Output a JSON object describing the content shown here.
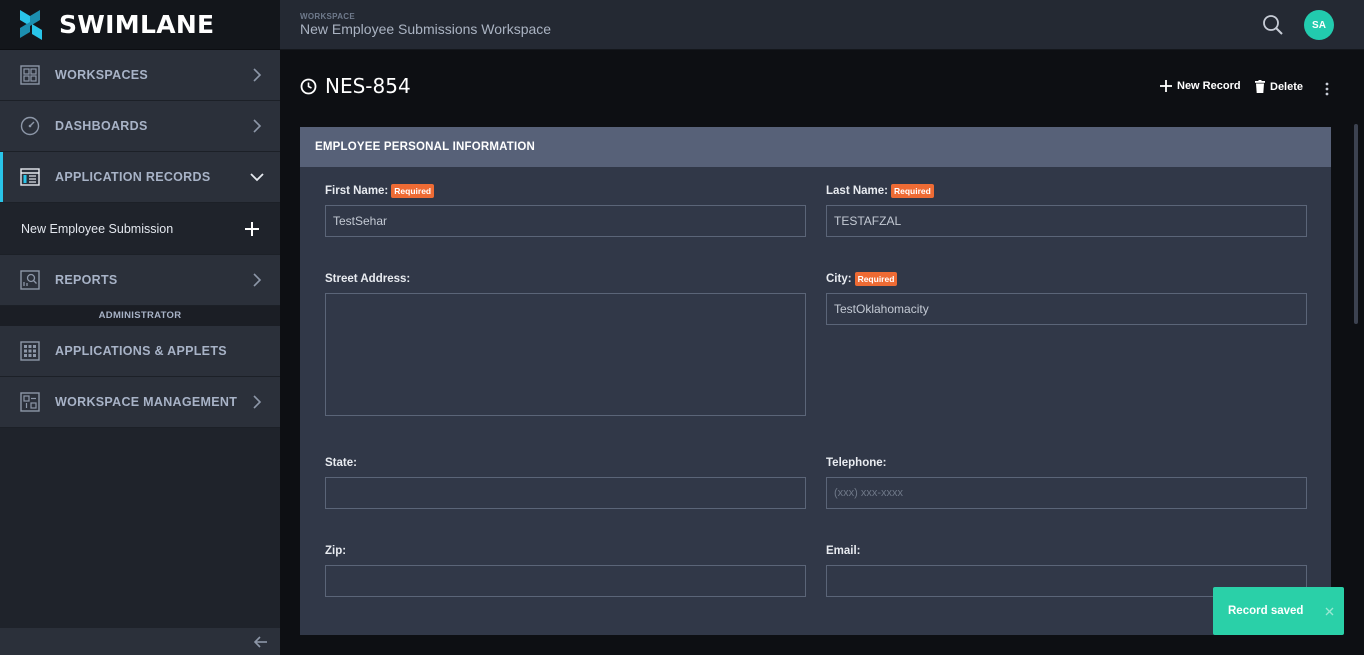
{
  "brand": {
    "name": "SWIMLANE",
    "logo_icon": "swimlane-logo-icon",
    "accent": "#29c4e8"
  },
  "sidebar": {
    "items": [
      {
        "label": "WORKSPACES",
        "icon": "workspaces-icon",
        "chevron": "chevron-right-icon"
      },
      {
        "label": "DASHBOARDS",
        "icon": "dashboard-gauge-icon",
        "chevron": "chevron-right-icon"
      },
      {
        "label": "APPLICATION RECORDS",
        "icon": "application-records-icon",
        "chevron": "chevron-down-icon",
        "active": true
      },
      {
        "label": "REPORTS",
        "icon": "reports-icon",
        "chevron": "chevron-right-icon"
      }
    ],
    "sub_item": {
      "label": "New Employee Submission",
      "icon": "plus-icon"
    },
    "admin_header": "ADMINISTRATOR",
    "admin_items": [
      {
        "label": "APPLICATIONS & APPLETS",
        "icon": "applications-grid-icon"
      },
      {
        "label": "WORKSPACE MANAGEMENT",
        "icon": "workspace-management-icon",
        "chevron": "chevron-right-icon"
      }
    ],
    "footer_icon": "collapse-arrow-left-icon"
  },
  "topbar": {
    "workspace_label": "WORKSPACE",
    "workspace_name": "New Employee Submissions Workspace",
    "search_icon": "search-icon",
    "avatar_initials": "SA",
    "avatar_color": "#22cbae"
  },
  "record": {
    "id": "NES-854",
    "icon": "clock-icon",
    "actions": {
      "new_record": "New Record",
      "delete": "Delete",
      "more_icon": "more-vertical-icon"
    }
  },
  "section": {
    "title": "EMPLOYEE PERSONAL INFORMATION",
    "required_badge": "Required",
    "fields": {
      "first_name": {
        "label": "First Name:",
        "value": "TestSehar",
        "required": true
      },
      "last_name": {
        "label": "Last Name:",
        "value": "TESTAFZAL",
        "required": true
      },
      "street": {
        "label": "Street Address:",
        "value": ""
      },
      "city": {
        "label": "City:",
        "value": "TestOklahomacity",
        "required": true
      },
      "state": {
        "label": "State:",
        "value": ""
      },
      "telephone": {
        "label": "Telephone:",
        "value": "",
        "placeholder": "(xxx) xxx-xxxx"
      },
      "zip": {
        "label": "Zip:",
        "value": ""
      },
      "email": {
        "label": "Email:",
        "value": ""
      }
    }
  },
  "toast": {
    "message": "Record saved",
    "close_icon": "close-icon",
    "color": "#2ad0a8"
  }
}
